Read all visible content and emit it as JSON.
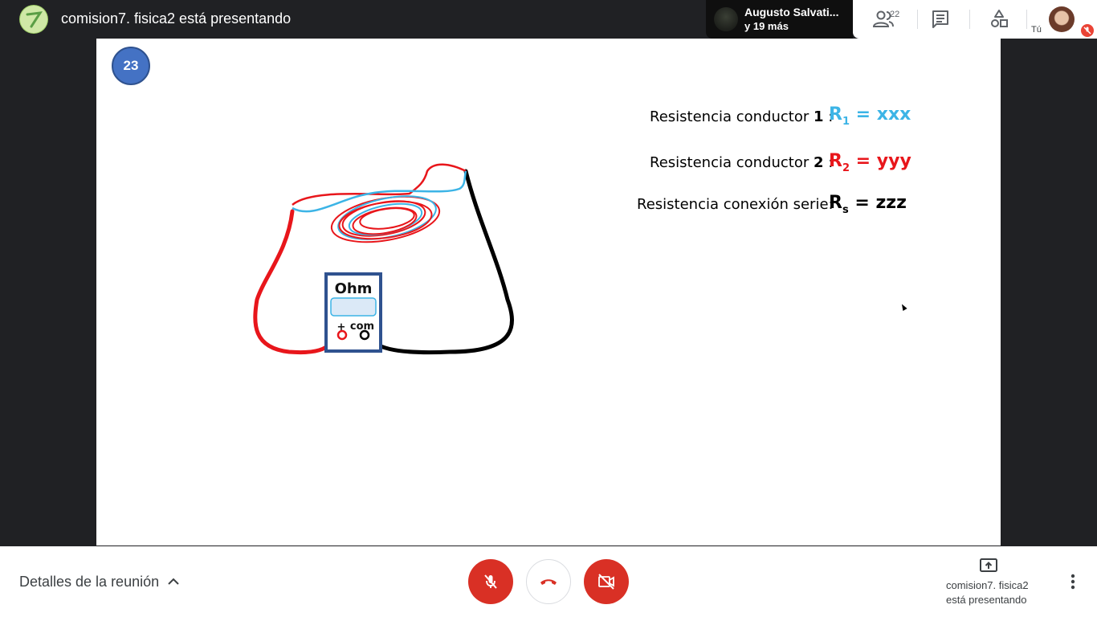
{
  "topbar": {
    "presenting_title": "comision7. fisica2 está presentando",
    "participant_name": "Augusto Salvati...",
    "participant_more": "y 19 más",
    "participant_count": "22",
    "self_label": "Tú"
  },
  "slide": {
    "number": "23",
    "lines": [
      {
        "prefix": "Resistencia conductor ",
        "bold": "1",
        "suffix": " :",
        "symbol": "R",
        "sub": "1",
        "value": "= xxx",
        "color": "#3cb4e6"
      },
      {
        "prefix": "Resistencia conductor ",
        "bold": "2",
        "suffix": " :",
        "symbol": "R",
        "sub": "2",
        "value": "= yyy",
        "color": "#e8161b"
      },
      {
        "prefix": "Resistencia conexión serie:",
        "bold": "",
        "suffix": "",
        "symbol": "R",
        "sub": "s",
        "value": "= zzz",
        "color": "#000000"
      }
    ],
    "meter": {
      "label": "Ohm",
      "plus": "+",
      "com": "com"
    }
  },
  "bottombar": {
    "meeting_details": "Detalles de la reunión",
    "presenting_line1": "comision7. fisica2",
    "presenting_line2": "está presentando"
  },
  "icons": {
    "people": "people-icon",
    "chat": "chat-icon",
    "activities": "activities-icon",
    "mic_off": "mic-off-icon",
    "hangup": "hangup-icon",
    "camera_off": "camera-off-icon",
    "present": "present-screen-icon",
    "more": "more-vert-icon"
  },
  "colors": {
    "danger": "#d93025",
    "slide_badge": "#4472c4",
    "wire_red": "#e8161b",
    "wire_blue": "#3cb4e6"
  }
}
